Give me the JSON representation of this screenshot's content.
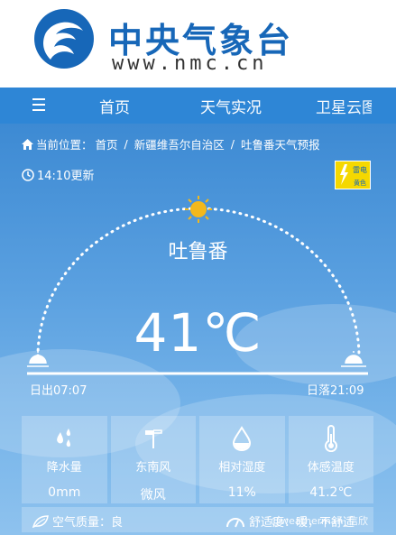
{
  "header": {
    "brand_cn": "中央气象台",
    "brand_en": "www.nmc.cn"
  },
  "nav": {
    "items": [
      "首页",
      "天气实况",
      "卫星云图"
    ]
  },
  "breadcrumb": {
    "prefix": "当前位置：",
    "items": [
      "首页",
      "新疆维吾尔自治区",
      "吐鲁番天气预报"
    ]
  },
  "update_time": "14:10更新",
  "warning": {
    "type": "雷电",
    "sub": "黄色",
    "color": "#f5d800"
  },
  "city": "吐鲁番",
  "temperature": "41℃",
  "sunrise": "日出07:07",
  "sunset": "日落21:09",
  "cards": [
    {
      "icon": "raindrops-icon",
      "label": "降水量",
      "value": "0mm"
    },
    {
      "icon": "wind-icon",
      "label": "东南风",
      "value": "微风"
    },
    {
      "icon": "humidity-drop-icon",
      "label": "相对湿度",
      "value": "11%"
    },
    {
      "icon": "thermometer-icon",
      "label": "体感温度",
      "value": "41.2℃"
    }
  ],
  "air_quality": "空气质量：良",
  "comfort": "舒适度：暖，不舒适",
  "watermark": "@weatherman_信欣",
  "colors": {
    "brand": "#1767b8",
    "nav": "#2e86d6",
    "sun": "#f2b81c"
  }
}
